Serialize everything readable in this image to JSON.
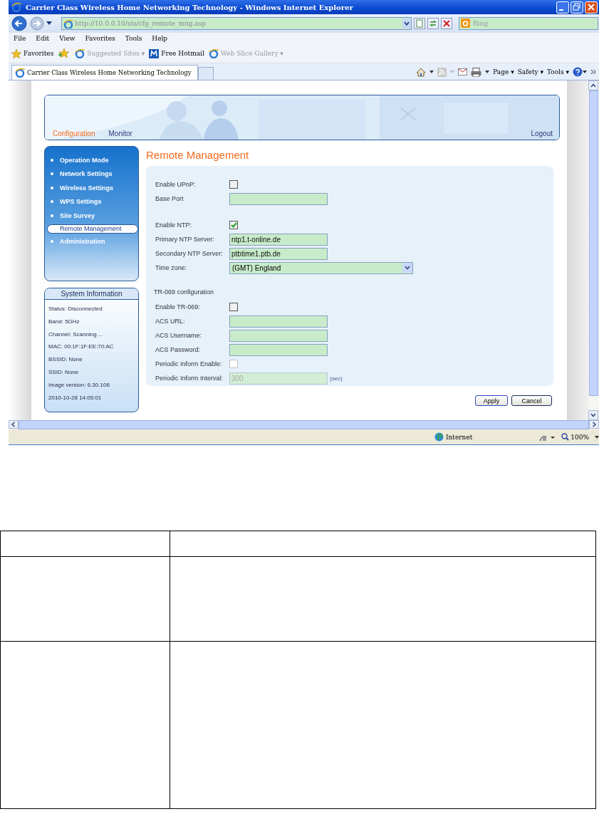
{
  "window": {
    "title": "Carrier Class Wireless Home Networking Technology - Windows Internet Explorer"
  },
  "address_bar": {
    "url": "http://10.0.0.10/sts/cfg_remote_mng.asp",
    "search_placeholder": "Bing"
  },
  "menu": [
    "File",
    "Edit",
    "View",
    "Favorites",
    "Tools",
    "Help"
  ],
  "favorites_bar": {
    "label": "Favorites",
    "items": [
      {
        "label": "Suggested Sites ▾",
        "disabled": true
      },
      {
        "label": "Free Hotmail",
        "disabled": false
      },
      {
        "label": "Web Slice Gallery ▾",
        "disabled": true
      }
    ]
  },
  "browser_tab": {
    "title": "Carrier Class Wireless Home Networking Technology"
  },
  "command_bar": [
    "Page ▾",
    "Safety ▾",
    "Tools ▾"
  ],
  "page": {
    "top_tabs": [
      {
        "label": "Configuration",
        "selected": true
      },
      {
        "label": "Monitor",
        "selected": false
      }
    ],
    "logout": "Logout",
    "sidebar": [
      {
        "label": "Operation Mode",
        "selected": false
      },
      {
        "label": "Network Settings",
        "selected": false
      },
      {
        "label": "Wireless Settings",
        "selected": false
      },
      {
        "label": "WPS Settings",
        "selected": false
      },
      {
        "label": "Site Survey",
        "selected": false
      },
      {
        "label": "Remote Management",
        "selected": true
      },
      {
        "label": "Administration",
        "selected": false
      }
    ],
    "system_information": {
      "title": "System Information",
      "lines": [
        "Status: Disconnected",
        "Band: 5GHz",
        "Channel: Scanning ...",
        "MAC: 00:1F:1F:EE:70:AC",
        "BSSID: None",
        "SSID: None",
        "Image version: 6.30.106",
        "2010-10-28 14:05:01"
      ]
    },
    "heading": "Remote Management",
    "groups": [
      {
        "fields": [
          {
            "kind": "checkbox",
            "label": "Enable UPnP:",
            "checked": false,
            "disabled": false
          },
          {
            "kind": "text",
            "label": "Base Port",
            "disabled": false
          }
        ]
      },
      {
        "fields": [
          {
            "kind": "checkbox",
            "label": "Enable NTP:",
            "checked": true,
            "disabled": false
          },
          {
            "kind": "text",
            "label": "Primary NTP Server:",
            "value": "ntp1.t-online.de",
            "disabled": false
          },
          {
            "kind": "text",
            "label": "Secondary NTP Server:",
            "value": "ptbtime1.ptb.de",
            "disabled": false
          },
          {
            "kind": "select",
            "label": "Time zone:",
            "value": "(GMT) England"
          }
        ]
      },
      {
        "title": "TR-069 configuration",
        "fields": [
          {
            "kind": "checkbox",
            "label": "Enable TR-069:",
            "checked": false,
            "disabled": false
          },
          {
            "kind": "text",
            "label": "ACS URL:",
            "disabled": false
          },
          {
            "kind": "text",
            "label": "ACS Username:",
            "disabled": false
          },
          {
            "kind": "text",
            "label": "ACS Password:",
            "disabled": false
          },
          {
            "kind": "checkbox",
            "label": "Periodic Inform Enable:",
            "checked": false,
            "disabled": true
          },
          {
            "kind": "text",
            "label": "Periodic Inform Interval:",
            "value": "300",
            "disabled": true,
            "suffix": "(sec)"
          }
        ]
      }
    ],
    "buttons": [
      "Apply",
      "Cancel"
    ]
  },
  "status_bar": {
    "zone": "Internet",
    "zoom": "100%"
  }
}
